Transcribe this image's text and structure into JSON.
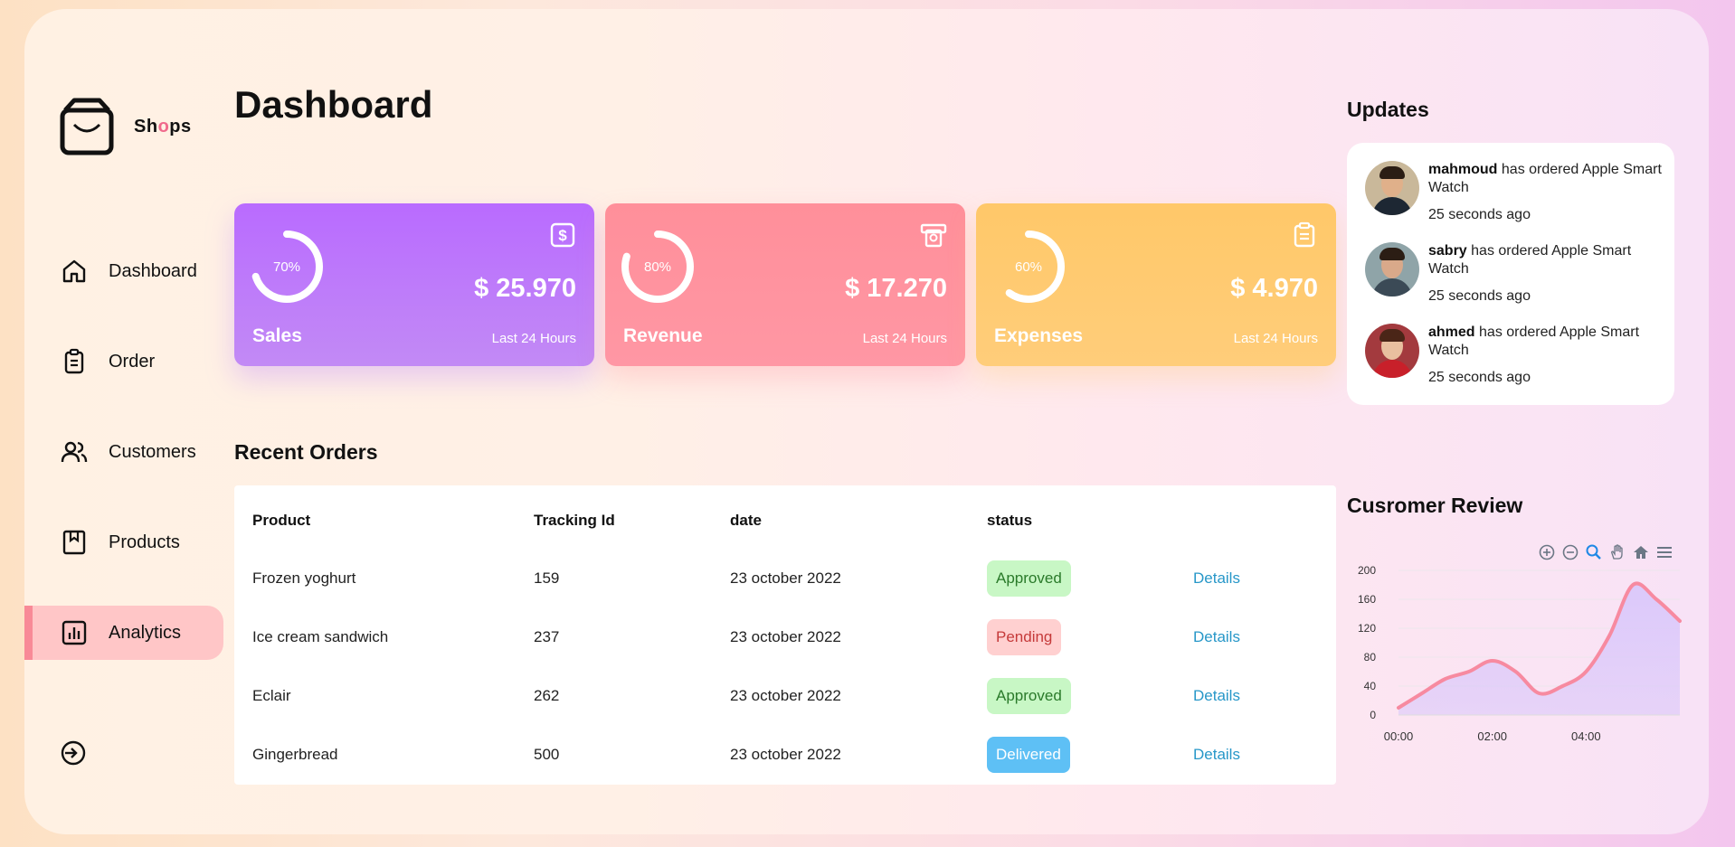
{
  "app": {
    "logo_text_prefix": "Sh",
    "logo_text_accent": "o",
    "logo_text_suffix": "ps",
    "accent_color": "#f06a8c"
  },
  "sidebar": {
    "items": [
      {
        "label": "Dashboard",
        "icon": "home-icon",
        "active": false
      },
      {
        "label": "Order",
        "icon": "clipboard-icon",
        "active": false
      },
      {
        "label": "Customers",
        "icon": "users-icon",
        "active": false
      },
      {
        "label": "Products",
        "icon": "box-icon",
        "active": false
      },
      {
        "label": "Analytics",
        "icon": "bar-chart-icon",
        "active": true
      }
    ],
    "logout_icon": "logout-icon"
  },
  "main": {
    "title": "Dashboard",
    "cards": [
      {
        "name": "Sales",
        "value": "$ 25.970",
        "sub": "Last 24 Hours",
        "percent_label": "70%",
        "percent": 70,
        "icon": "dollar-icon",
        "color": "#b96bff"
      },
      {
        "name": "Revenue",
        "value": "$ 17.270",
        "sub": "Last 24 Hours",
        "percent_label": "80%",
        "percent": 80,
        "icon": "cash-icon",
        "color": "#ff8f9a"
      },
      {
        "name": "Expenses",
        "value": "$ 4.970",
        "sub": "Last 24 Hours",
        "percent_label": "60%",
        "percent": 60,
        "icon": "clipboard-icon",
        "color": "#ffc869"
      }
    ],
    "recent_orders": {
      "title": "Recent Orders",
      "columns": [
        "Product",
        "Tracking Id",
        "date",
        "status"
      ],
      "rows": [
        {
          "product": "Frozen yoghurt",
          "tracking": "159",
          "date": "23 october 2022",
          "status": "Approved",
          "status_type": "approved",
          "action": "Details"
        },
        {
          "product": "Ice cream sandwich",
          "tracking": "237",
          "date": "23 october 2022",
          "status": "Pending",
          "status_type": "pending",
          "action": "Details"
        },
        {
          "product": "Eclair",
          "tracking": "262",
          "date": "23 october 2022",
          "status": "Approved",
          "status_type": "approved",
          "action": "Details"
        },
        {
          "product": "Gingerbread",
          "tracking": "500",
          "date": "23 october 2022",
          "status": "Delivered",
          "status_type": "delivered",
          "action": "Details"
        }
      ]
    }
  },
  "updates": {
    "title": "Updates",
    "items": [
      {
        "name": "mahmoud",
        "text": " has ordered Apple Smart Watch",
        "time": "25 seconds ago"
      },
      {
        "name": "sabry",
        "text": " has ordered Apple Smart Watch",
        "time": "25 seconds ago"
      },
      {
        "name": "ahmed",
        "text": " has ordered Apple Smart Watch",
        "time": "25 seconds ago"
      }
    ]
  },
  "review": {
    "title": "Cusromer Review",
    "tools": [
      "zoom-in-icon",
      "zoom-out-icon",
      "search-icon",
      "pan-icon",
      "home-icon",
      "menu-icon"
    ]
  },
  "chart_data": {
    "type": "area",
    "title": "",
    "xlabel": "",
    "ylabel": "",
    "x_ticks": [
      "00:00",
      "02:00",
      "04:00"
    ],
    "y_ticks": [
      0,
      40,
      80,
      120,
      160,
      200
    ],
    "ylim": [
      0,
      200
    ],
    "xlim": [
      0,
      6
    ],
    "x": [
      0,
      0.5,
      1,
      1.5,
      2,
      2.5,
      3,
      3.5,
      4,
      4.5,
      5,
      5.5,
      6
    ],
    "values": [
      10,
      30,
      50,
      60,
      75,
      60,
      30,
      40,
      60,
      110,
      180,
      160,
      130
    ],
    "line_color": "#f78aa0",
    "fill_color": "#d8c6fb",
    "grid": true
  }
}
